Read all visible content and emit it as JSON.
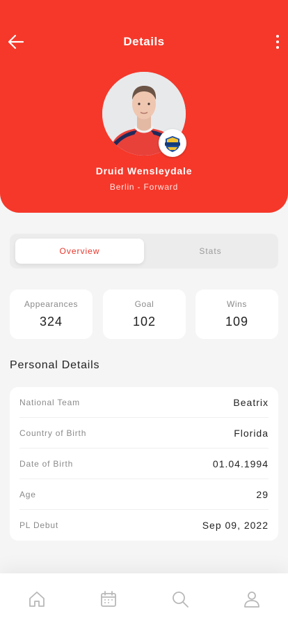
{
  "header": {
    "title": "Details",
    "back_icon": "arrow-left-icon",
    "more_icon": "more-vertical-icon",
    "background_color": "#f5382a"
  },
  "player": {
    "name": "Druid Wensleydale",
    "subtitle": "Berlin - Forward",
    "badge_icon": "club-badge-icon"
  },
  "tabs": [
    {
      "label": "Overview",
      "active": true
    },
    {
      "label": "Stats",
      "active": false
    }
  ],
  "stats": [
    {
      "label": "Appearances",
      "value": "324"
    },
    {
      "label": "Goal",
      "value": "102"
    },
    {
      "label": "Wins",
      "value": "109"
    }
  ],
  "personal": {
    "title": "Personal Details",
    "rows": [
      {
        "key": "National Team",
        "value": "Beatrix"
      },
      {
        "key": "Country of Birth",
        "value": "Florida"
      },
      {
        "key": "Date of Birth",
        "value": "01.04.1994"
      },
      {
        "key": "Age",
        "value": "29"
      },
      {
        "key": "PL Debut",
        "value": "Sep 09, 2022"
      }
    ]
  },
  "bottom_nav": [
    {
      "icon": "home-icon"
    },
    {
      "icon": "calendar-icon"
    },
    {
      "icon": "search-icon"
    },
    {
      "icon": "user-icon"
    }
  ]
}
